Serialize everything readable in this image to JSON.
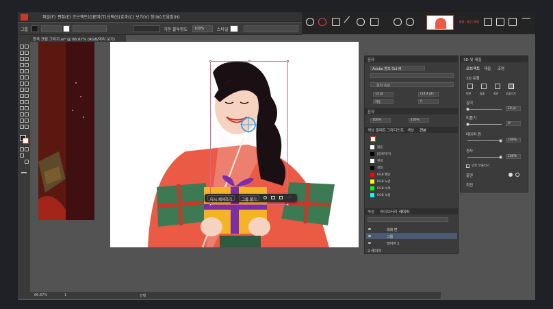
{
  "menubar": {
    "items": [
      "파일(F)",
      "편집(E)",
      "오브젝트(O)",
      "문자(T)",
      "선택(S)",
      "효과(C)",
      "보기(V)",
      "창(W)",
      "도움말(H)"
    ]
  },
  "recorder": {
    "time": "00:02:09"
  },
  "control": {
    "group_label": "그룹",
    "opacity_label": "불투명도",
    "opacity_value": "100%",
    "style_label": "스타일",
    "stroke_style": "기본"
  },
  "document": {
    "tab_title": "한국 크림 그리기.ai* @ 66.67% (RGB/미리 보기)"
  },
  "context_bar": {
    "isolate_label": "다시 채색하기",
    "ungroup_label": "그룹 풀기"
  },
  "panel_char": {
    "tabs": [
      "문자"
    ],
    "font_family": "Adobe 명조 Std M",
    "font_style": "",
    "search_placeholder": "문자 속성",
    "size_value": "12 pt",
    "leading_value": "(14.4 pt)",
    "tracking_value": "0",
    "kerning_value": "자동",
    "vscale_value": "100%",
    "hscale_value": "100%"
  },
  "panel_swatches": {
    "tabs": [
      "색상 팔레트",
      "그라디언트",
      "색상",
      "견본"
    ],
    "swatches": [
      {
        "name": "없음",
        "color": "#ffffff"
      },
      {
        "name": "[등록하기]",
        "color": "#000000"
      },
      {
        "name": "흰색",
        "color": "#ffffff"
      },
      {
        "name": "검정",
        "color": "#000000"
      },
      {
        "name": "RGB 빨강",
        "color": "#ff0000"
      },
      {
        "name": "RGB 노랑",
        "color": "#ffff00"
      },
      {
        "name": "RGB 녹색",
        "color": "#00ff00"
      },
      {
        "name": "RGB 녹청",
        "color": "#00ffff"
      }
    ]
  },
  "panel_layers": {
    "tabs": [
      "속성",
      "라이브러리",
      "레이어"
    ],
    "layers": [
      {
        "name": "대화 면",
        "selected": false
      },
      {
        "name": "그룹",
        "selected": true
      },
      {
        "name": "레이어 1",
        "selected": false
      }
    ],
    "count_label": "2 레이어"
  },
  "panel_3d": {
    "tabs": [
      "3D 및 재질"
    ],
    "subtabs": [
      "오브젝트",
      "재질",
      "조명"
    ],
    "section": "3D 유형",
    "types": [
      "평면",
      "돌출",
      "회전",
      "부풀리기"
    ],
    "depth_label": "깊이",
    "depth_value": "10 pt",
    "twist_label": "비틀기",
    "twist_value": "0°",
    "taper_label": "테이퍼 원",
    "taper_value": "100%",
    "bevel_label": "경사",
    "bevel_value": "100%",
    "inflate_label": "양쪽 부풀리기",
    "cap_label": "끝면",
    "rotate_label": "회전",
    "rotate_value": "0°"
  },
  "statusbar": {
    "zoom": "66.67%",
    "artboard": "1",
    "tool": "선택"
  },
  "colors": {
    "kimono": "#ea5a44",
    "gift_yellow": "#f5b326",
    "ribbon_purple": "#7a2fa8",
    "gift_green": "#3d7a54",
    "skirt_green": "#2e5a3e",
    "hair": "#1a1013",
    "skin": "#f5d3c0",
    "accent_red": "#c7392b",
    "selection_pink": "#d36a8a"
  }
}
